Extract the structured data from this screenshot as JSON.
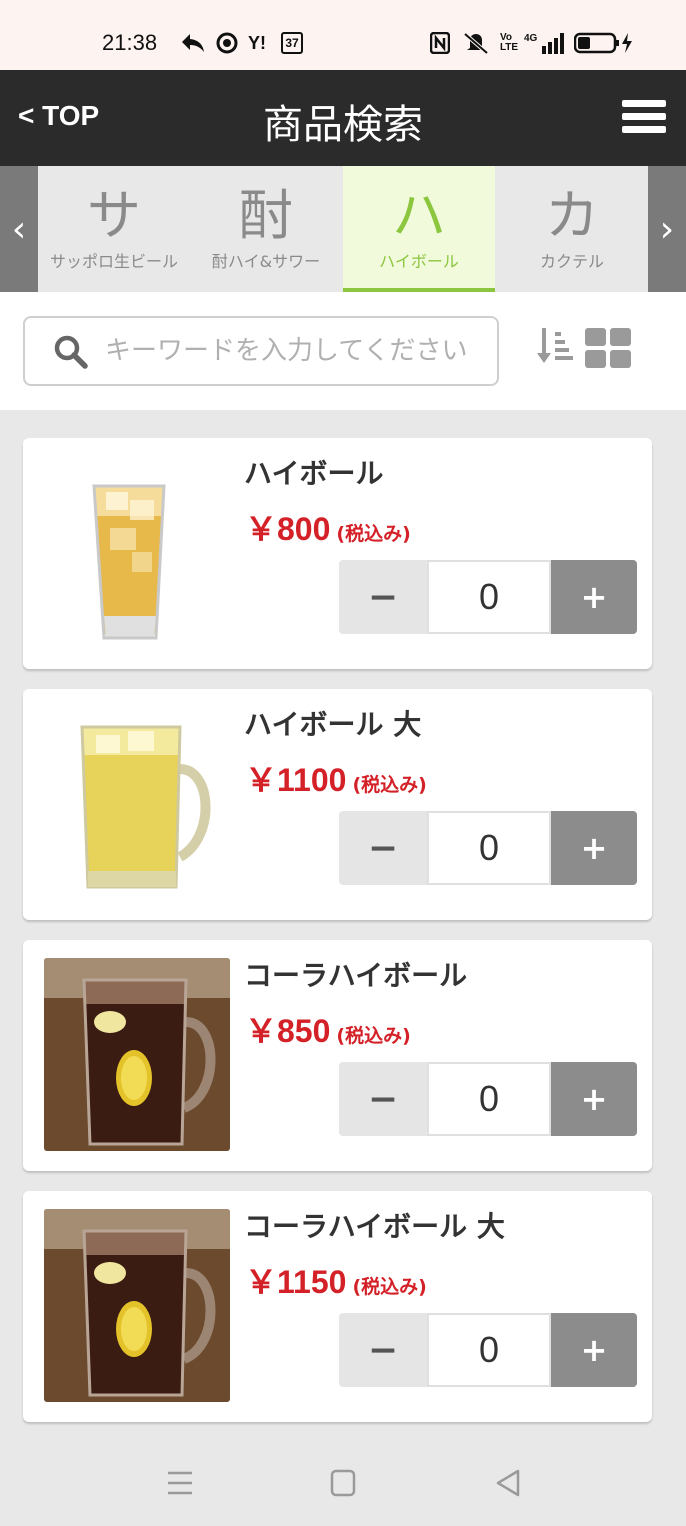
{
  "status_bar": {
    "time": "21:38",
    "yahoo": "Y!",
    "badge": "37",
    "network": "4G",
    "volte": "Vo LTE"
  },
  "header": {
    "back_label": "< TOP",
    "title": "商品検索",
    "menu_icon": "hamburger-icon"
  },
  "category_tabs": [
    {
      "initial": "サ",
      "label": "サッポロ生ビール",
      "active": false
    },
    {
      "initial": "酎",
      "label": "酎ハイ&サワー",
      "active": false
    },
    {
      "initial": "ハ",
      "label": "ハイボール",
      "active": true
    },
    {
      "initial": "カ",
      "label": "カクテル",
      "active": false
    }
  ],
  "search": {
    "placeholder": "キーワードを入力してください",
    "value": ""
  },
  "products": [
    {
      "name": "ハイボール",
      "price": "￥800",
      "tax_note": "(税込み)",
      "quantity": "0",
      "minus_label": "−",
      "plus_label": "+"
    },
    {
      "name": "ハイボール 大",
      "price": "￥1100",
      "tax_note": "(税込み)",
      "quantity": "0",
      "minus_label": "−",
      "plus_label": "+"
    },
    {
      "name": "コーラハイボール",
      "price": "￥850",
      "tax_note": "(税込み)",
      "quantity": "0",
      "minus_label": "−",
      "plus_label": "+"
    },
    {
      "name": "コーラハイボール 大",
      "price": "￥1150",
      "tax_note": "(税込み)",
      "quantity": "0",
      "minus_label": "−",
      "plus_label": "+"
    }
  ],
  "colors": {
    "header_bg": "#2b2b2b",
    "active_tab_accent": "#8cc63f",
    "active_tab_bg": "#f1fbdc",
    "price_red": "#d42027",
    "plus_button": "#8c8c8c"
  }
}
